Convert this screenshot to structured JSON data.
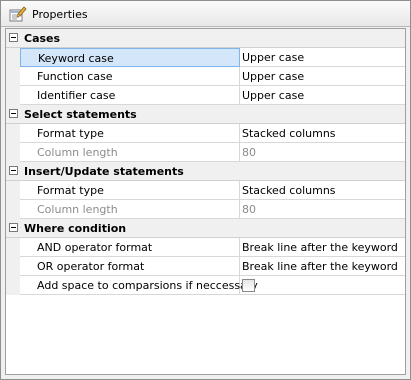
{
  "window": {
    "title": "Properties",
    "icon": "properties-pencil-icon"
  },
  "categories": [
    {
      "label": "Cases",
      "rows": [
        {
          "name": "Keyword case",
          "value": "Upper case",
          "selected": true
        },
        {
          "name": "Function case",
          "value": "Upper case"
        },
        {
          "name": "Identifier case",
          "value": "Upper case"
        }
      ]
    },
    {
      "label": "Select statements",
      "rows": [
        {
          "name": "Format type",
          "value": "Stacked columns"
        },
        {
          "name": "Column length",
          "value": "80",
          "disabled": true
        }
      ]
    },
    {
      "label": "Insert/Update statements",
      "rows": [
        {
          "name": "Format type",
          "value": "Stacked columns"
        },
        {
          "name": "Column length",
          "value": "80",
          "disabled": true
        }
      ]
    },
    {
      "label": "Where condition",
      "rows": [
        {
          "name": "AND operator format",
          "value": "Break line after the keyword"
        },
        {
          "name": "OR operator format",
          "value": "Break line after the keyword"
        },
        {
          "name": "Add space to comparsions if neccessary",
          "value": "",
          "checkbox": true,
          "checked": false
        }
      ]
    }
  ]
}
